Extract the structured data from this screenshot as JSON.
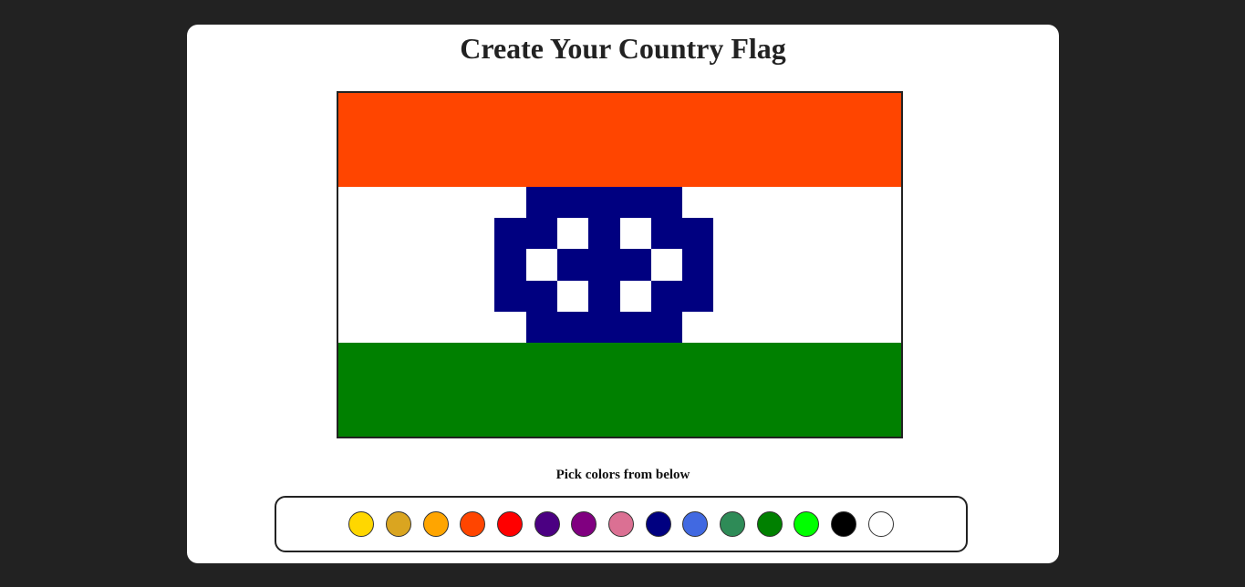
{
  "title": "Create Your Country Flag",
  "picker_label": "Pick colors from below",
  "flag": {
    "rows": 11,
    "cols": 18,
    "default_color": "#ffffff",
    "band_colors": {
      "top": "#ff4500",
      "middle": "#ffffff",
      "bottom": "#008000"
    },
    "emblem_color": "#000080",
    "emblem_cells": [
      [
        3,
        6
      ],
      [
        3,
        7
      ],
      [
        3,
        8
      ],
      [
        3,
        9
      ],
      [
        3,
        10
      ],
      [
        4,
        5
      ],
      [
        4,
        6
      ],
      [
        4,
        8
      ],
      [
        4,
        10
      ],
      [
        4,
        11
      ],
      [
        5,
        5
      ],
      [
        5,
        7
      ],
      [
        5,
        8
      ],
      [
        5,
        9
      ],
      [
        5,
        11
      ],
      [
        6,
        5
      ],
      [
        6,
        6
      ],
      [
        6,
        8
      ],
      [
        6,
        10
      ],
      [
        6,
        11
      ],
      [
        7,
        6
      ],
      [
        7,
        7
      ],
      [
        7,
        8
      ],
      [
        7,
        9
      ],
      [
        7,
        10
      ]
    ]
  },
  "palette": [
    {
      "name": "gold",
      "color": "#ffd700"
    },
    {
      "name": "goldenrod",
      "color": "#daa520"
    },
    {
      "name": "orange",
      "color": "#ffa500"
    },
    {
      "name": "orangered",
      "color": "#ff4500"
    },
    {
      "name": "red",
      "color": "#ff0000"
    },
    {
      "name": "indigo",
      "color": "#4b0082"
    },
    {
      "name": "purple",
      "color": "#800080"
    },
    {
      "name": "palevioletred",
      "color": "#db7093"
    },
    {
      "name": "navy",
      "color": "#000080"
    },
    {
      "name": "royalblue",
      "color": "#4169e1"
    },
    {
      "name": "seagreen",
      "color": "#2e8b57"
    },
    {
      "name": "green",
      "color": "#008000"
    },
    {
      "name": "lime",
      "color": "#00ff00"
    },
    {
      "name": "black",
      "color": "#000000"
    },
    {
      "name": "white",
      "color": "#ffffff"
    }
  ]
}
